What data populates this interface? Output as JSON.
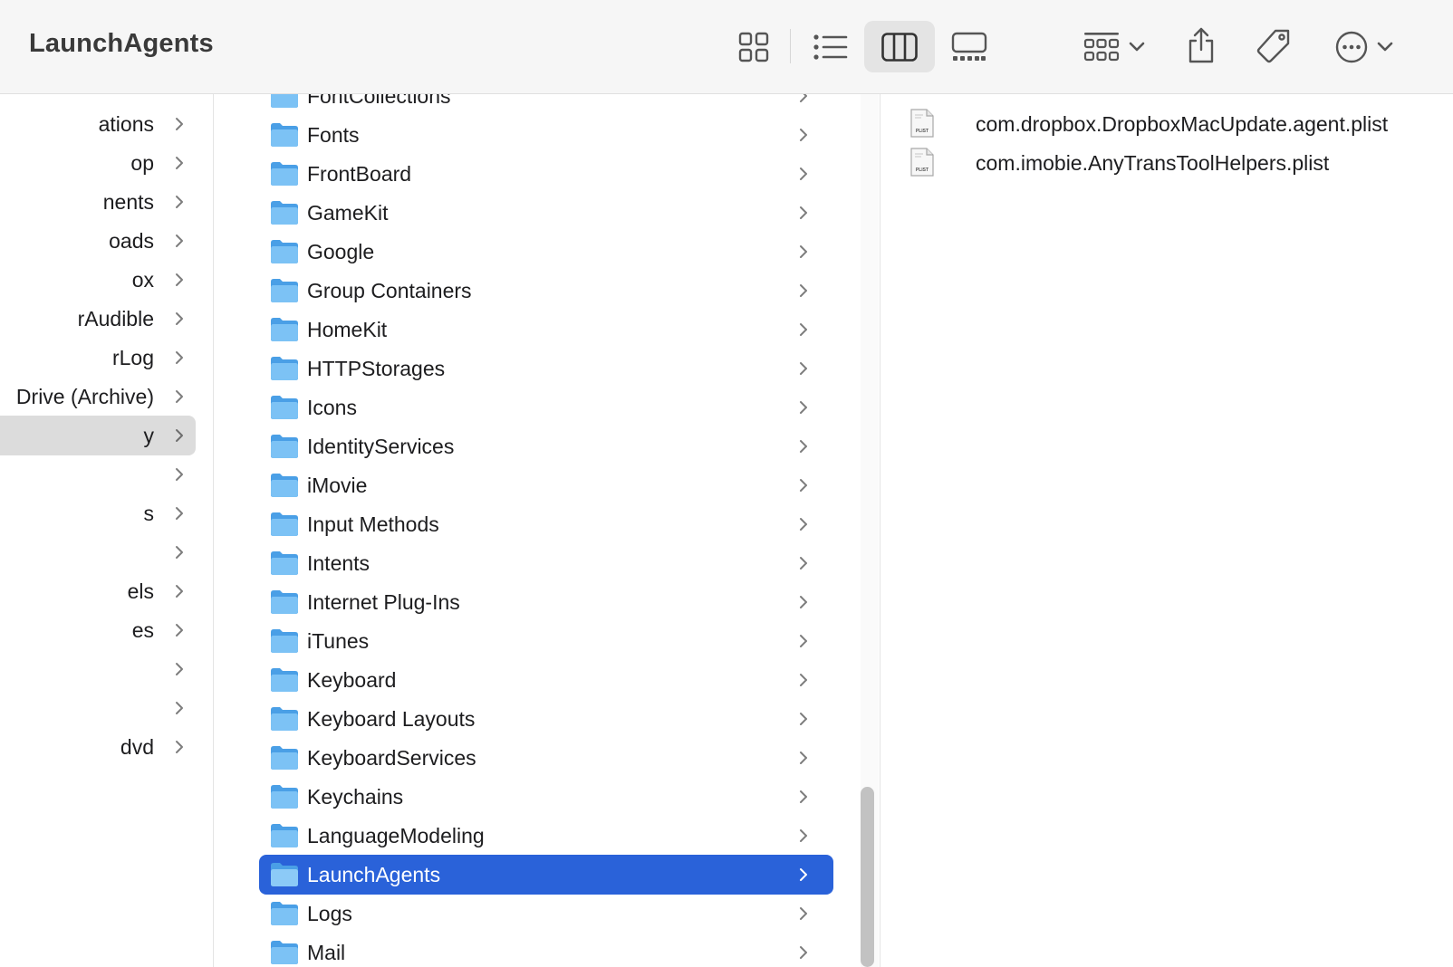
{
  "window": {
    "title": "LaunchAgents"
  },
  "toolbar": {
    "views": [
      "icon-view",
      "list-view",
      "column-view",
      "gallery-view"
    ],
    "active_view": "column-view",
    "group_button": "group",
    "share_button": "share",
    "tags_button": "tags",
    "more_button": "more"
  },
  "sidebar": {
    "items": [
      {
        "label": "ations"
      },
      {
        "label": "op"
      },
      {
        "label": "nents"
      },
      {
        "label": "oads"
      },
      {
        "label": "ox"
      },
      {
        "label": "rAudible"
      },
      {
        "label": "rLog"
      },
      {
        "label": " Drive (Archive)"
      },
      {
        "label": "y",
        "selected": true
      },
      {
        "label": ""
      },
      {
        "label": "s"
      },
      {
        "label": ""
      },
      {
        "label": "els"
      },
      {
        "label": "es"
      },
      {
        "label": ""
      },
      {
        "label": ""
      },
      {
        "label": "dvd"
      }
    ]
  },
  "library": {
    "items": [
      {
        "label": "FontCollections"
      },
      {
        "label": "Fonts"
      },
      {
        "label": "FrontBoard"
      },
      {
        "label": "GameKit"
      },
      {
        "label": "Google"
      },
      {
        "label": "Group Containers"
      },
      {
        "label": "HomeKit"
      },
      {
        "label": "HTTPStorages"
      },
      {
        "label": "Icons"
      },
      {
        "label": "IdentityServices"
      },
      {
        "label": "iMovie"
      },
      {
        "label": "Input Methods"
      },
      {
        "label": "Intents"
      },
      {
        "label": "Internet Plug-Ins"
      },
      {
        "label": "iTunes"
      },
      {
        "label": "Keyboard"
      },
      {
        "label": "Keyboard Layouts"
      },
      {
        "label": "KeyboardServices"
      },
      {
        "label": "Keychains"
      },
      {
        "label": "LanguageModeling"
      },
      {
        "label": "LaunchAgents",
        "selected": true
      },
      {
        "label": "Logs"
      },
      {
        "label": "Mail"
      }
    ]
  },
  "files": {
    "items": [
      {
        "label": "com.dropbox.DropboxMacUpdate.agent.plist",
        "badge": "PLIST"
      },
      {
        "label": "com.imobie.AnyTransToolHelpers.plist",
        "badge": "PLIST"
      }
    ]
  },
  "colors": {
    "selection": "#2a62d9",
    "folder": "#6cb6f0",
    "sidebar_selection": "#dcdcdc"
  }
}
